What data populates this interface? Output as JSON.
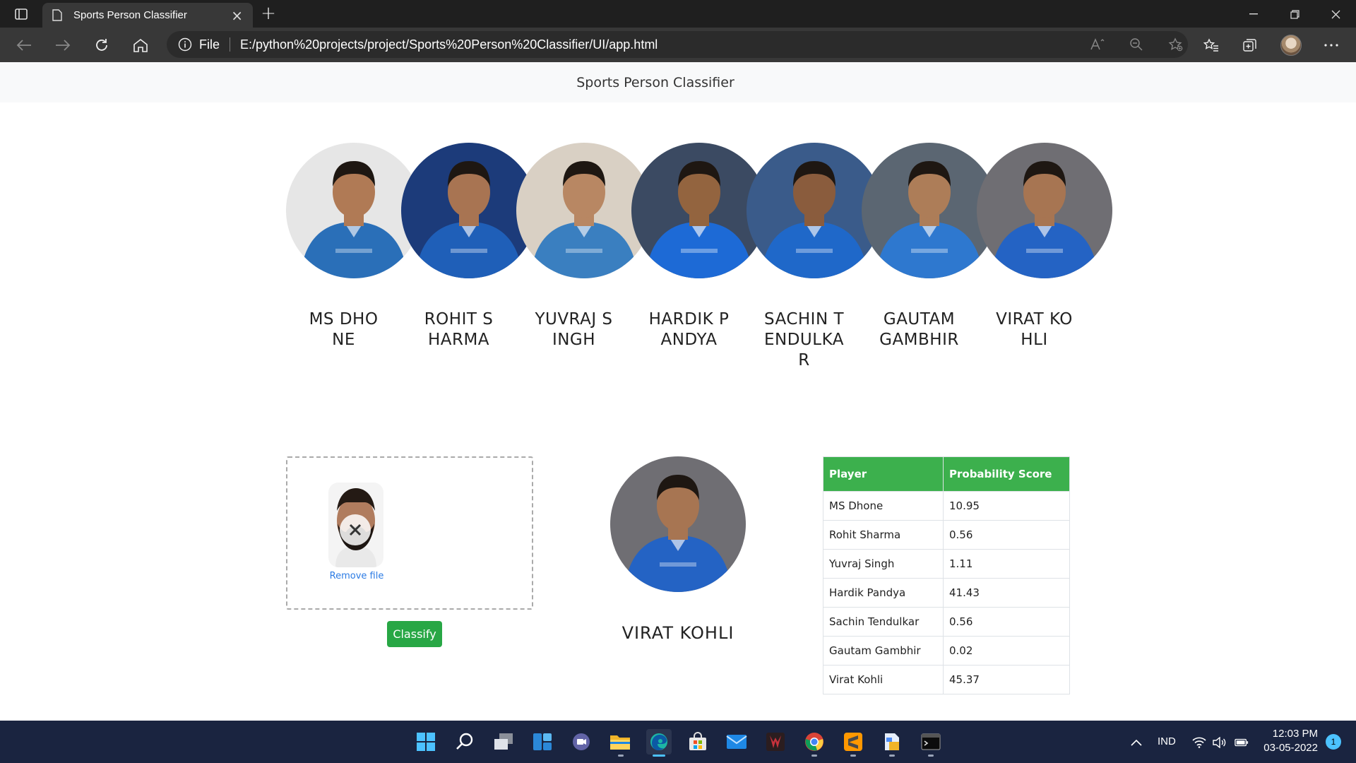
{
  "browser": {
    "tab_title": "Sports Person Classifier",
    "tab_close": "×",
    "new_tab": "+",
    "address_scheme": "File",
    "address_url": "E:/python%20projects/project/Sports%20Person%20Classifier/UI/app.html"
  },
  "navbar": {
    "brand": "Sports Person Classifier"
  },
  "players": [
    {
      "name": "MS DHONE",
      "jersey": "#2a6fb8",
      "bg": "#e6e6e6",
      "skin": "#b07a55"
    },
    {
      "name": "ROHIT SHARMA",
      "jersey": "#1f5fb8",
      "bg": "#1c3b7a",
      "skin": "#a87452"
    },
    {
      "name": "YUVRAJ SINGH",
      "jersey": "#3a7fc0",
      "bg": "#d9d0c4",
      "skin": "#b88763"
    },
    {
      "name": "HARDIK PANDYA",
      "jersey": "#1d6ad6",
      "bg": "#3b4a62",
      "skin": "#93643f"
    },
    {
      "name": "SACHIN TENDULKAR",
      "jersey": "#1f68c9",
      "bg": "#3a5b8a",
      "skin": "#8a5c3d"
    },
    {
      "name": "GAUTAM GAMBHIR",
      "jersey": "#2e78cf",
      "bg": "#5b6672",
      "skin": "#ad7d58"
    },
    {
      "name": "VIRAT KOHLI",
      "jersey": "#2463c4",
      "bg": "#6f6e73",
      "skin": "#a77552"
    }
  ],
  "upload": {
    "remove_label": "Remove file",
    "classify_label": "Classify"
  },
  "result": {
    "name": "VIRAT KOHLI"
  },
  "table": {
    "headers": [
      "Player",
      "Probability Score"
    ],
    "rows": [
      [
        "MS Dhone",
        "10.95"
      ],
      [
        "Rohit Sharma",
        "0.56"
      ],
      [
        "Yuvraj Singh",
        "1.11"
      ],
      [
        "Hardik Pandya",
        "41.43"
      ],
      [
        "Sachin Tendulkar",
        "0.56"
      ],
      [
        "Gautam Gambhir",
        "0.02"
      ],
      [
        "Virat Kohli",
        "45.37"
      ]
    ]
  },
  "taskbar": {
    "language": "IND",
    "time": "12:03 PM",
    "date": "03-05-2022",
    "notifications": "1",
    "apps": [
      "start-icon",
      "search-icon",
      "task-view-icon",
      "widgets-icon",
      "teams-chat-icon",
      "file-explorer-icon",
      "edge-icon",
      "store-icon",
      "mail-icon",
      "game-app-icon",
      "chrome-icon",
      "sublime-text-icon",
      "file-manager-icon",
      "terminal-icon"
    ]
  },
  "colors": {
    "accent_green": "#28a745",
    "table_header_green": "#3cb04d",
    "link_blue": "#2b7be4",
    "navbar_bg": "#f8f9fa",
    "taskbar_bg": "#1a2440"
  }
}
